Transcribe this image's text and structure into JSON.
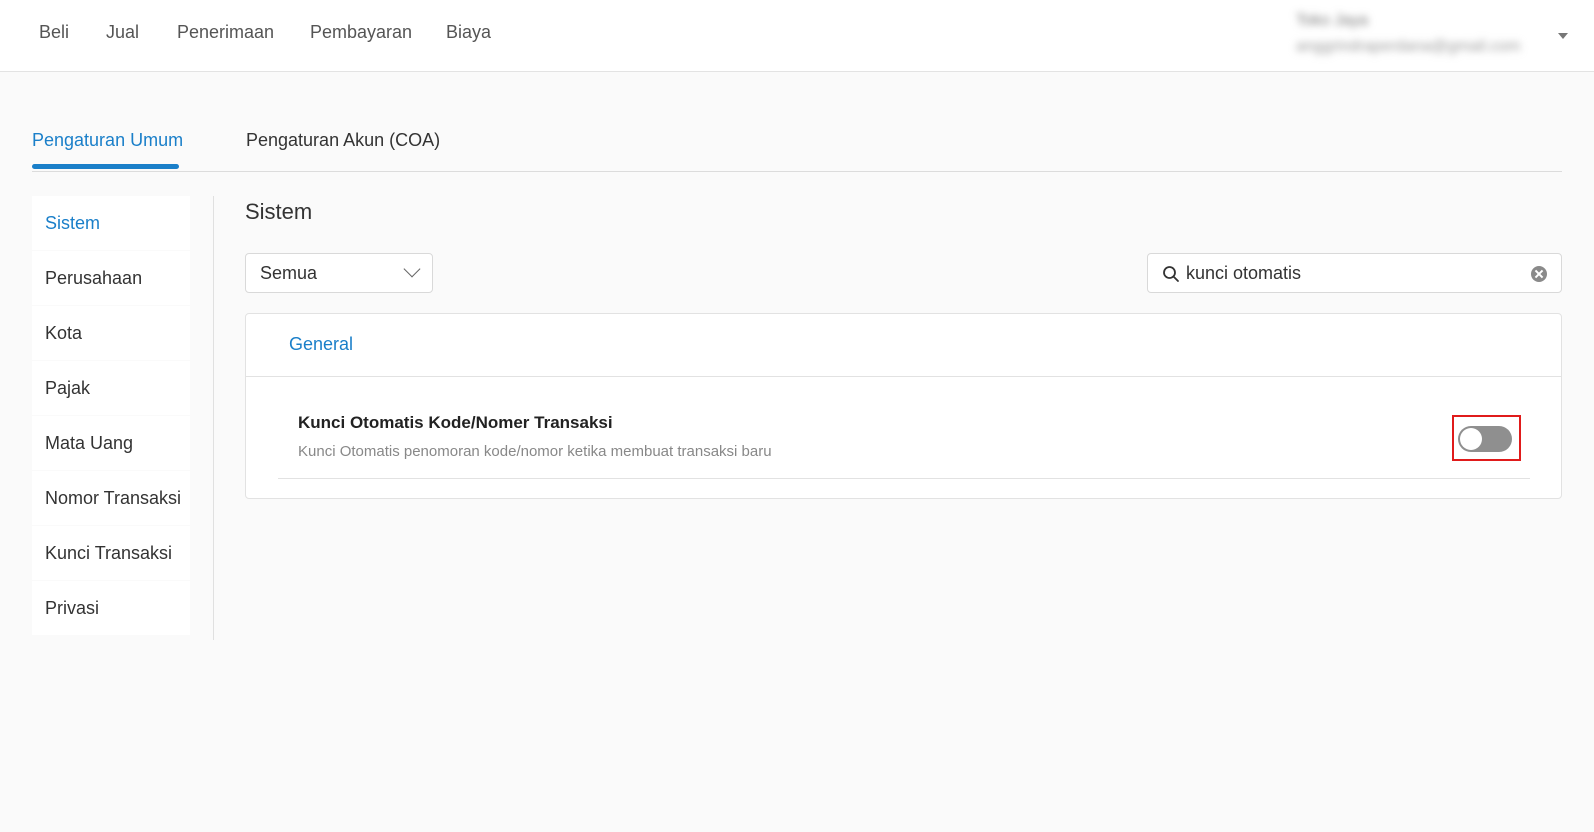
{
  "topnav": {
    "items": [
      "Beli",
      "Jual",
      "Penerimaan",
      "Pembayaran",
      "Biaya"
    ],
    "user_name": "Toko Jaya",
    "user_email": "anggrindraperdana@gmail.com"
  },
  "tabs": [
    {
      "label": "Pengaturan Umum",
      "active": true
    },
    {
      "label": "Pengaturan Akun (COA)",
      "active": false
    }
  ],
  "sidebar": {
    "items": [
      {
        "label": "Sistem",
        "active": true
      },
      {
        "label": "Perusahaan"
      },
      {
        "label": "Kota"
      },
      {
        "label": "Pajak"
      },
      {
        "label": "Mata Uang"
      },
      {
        "label": "Nomor Transaksi"
      },
      {
        "label": "Kunci Transaksi"
      },
      {
        "label": "Privasi"
      }
    ]
  },
  "main": {
    "title": "Sistem",
    "filter": {
      "selected": "Semua"
    },
    "search": {
      "value": "kunci otomatis"
    },
    "card": {
      "header": "General",
      "setting": {
        "title": "Kunci Otomatis Kode/Nomer Transaksi",
        "description": "Kunci Otomatis penomoran kode/nomor ketika membuat transaksi baru",
        "enabled": false
      }
    }
  },
  "colors": {
    "accent": "#1a7fc9",
    "highlight": "#e01b1b",
    "toggle_off": "#8f8f8f"
  }
}
